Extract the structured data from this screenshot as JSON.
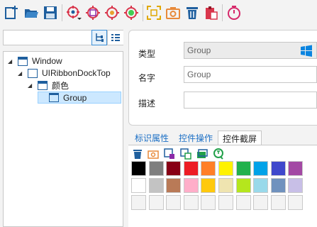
{
  "toolbar": {
    "icons": [
      "new-icon",
      "open-folder-icon",
      "save-icon",
      "target-dropdown-icon",
      "target-image-icon",
      "target-spy-icon",
      "target-qt-icon",
      "capture-region-icon",
      "camera-icon",
      "delete-icon",
      "paste-icon",
      "timer-icon"
    ]
  },
  "search": {
    "value": "",
    "placeholder": ""
  },
  "tree": {
    "nodes": [
      {
        "label": "Window"
      },
      {
        "label": "UIRibbonDockTop"
      },
      {
        "label": "颜色"
      },
      {
        "label": "Group"
      }
    ]
  },
  "properties": {
    "type_label": "类型",
    "type_value": "Group",
    "name_label": "名字",
    "name_value": "Group",
    "desc_label": "描述",
    "desc_value": ""
  },
  "tabs": [
    {
      "label": "标识属性"
    },
    {
      "label": "控件操作"
    },
    {
      "label": "控件截屏"
    }
  ],
  "colors": {
    "accent": "#0078d7",
    "row1": [
      "#000000",
      "#7f7f7f",
      "#880015",
      "#ed1c24",
      "#ff7f27",
      "#fff200",
      "#22b14c",
      "#00a2e8",
      "#3f48cc",
      "#a349a4"
    ],
    "row2": [
      "#ffffff",
      "#c3c3c3",
      "#b97a57",
      "#ffaec9",
      "#ffc90e",
      "#efe4b0",
      "#b5e61d",
      "#99d9ea",
      "#7092be",
      "#c8bfe7"
    ],
    "row3": [
      "#f3f3f3",
      "#f3f3f3",
      "#f3f3f3",
      "#f3f3f3",
      "#f3f3f3",
      "#f3f3f3",
      "#f3f3f3",
      "#f3f3f3",
      "#f3f3f3",
      "#f3f3f3"
    ]
  }
}
